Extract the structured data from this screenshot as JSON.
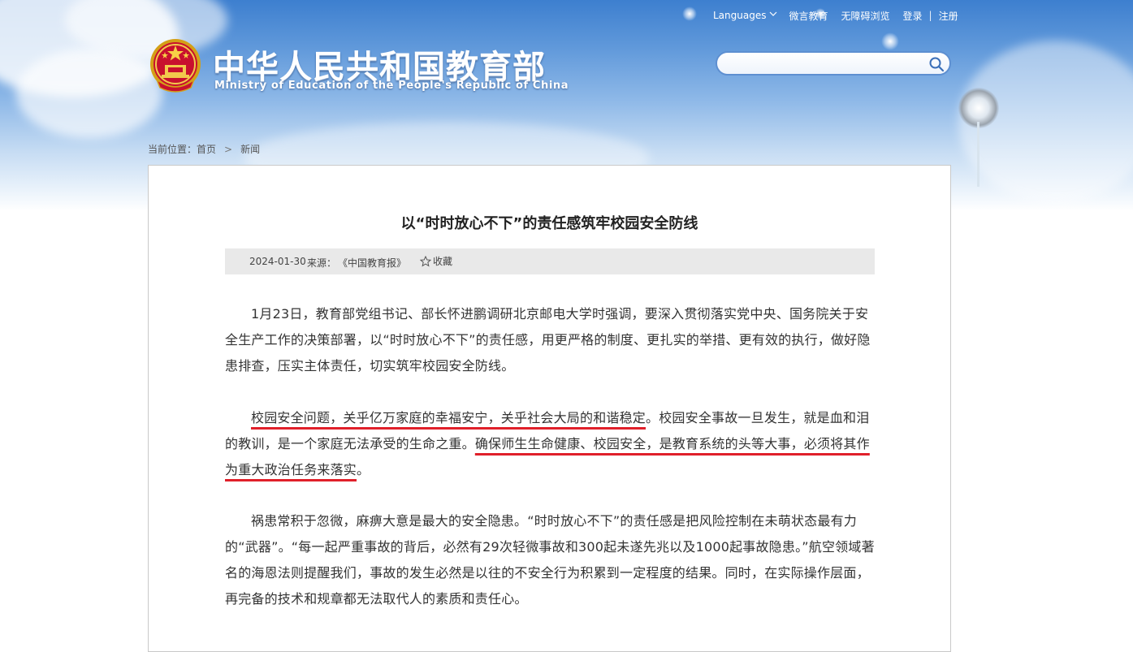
{
  "header": {
    "languages_label": "Languages",
    "links": [
      "微言教育",
      "无障碍浏览",
      "登录",
      "注册"
    ],
    "brand_cn": "中华人民共和国教育部",
    "brand_en": "Ministry of Education of the People's Republic of China",
    "search": {
      "placeholder": "",
      "value": ""
    }
  },
  "breadcrumb": {
    "prefix": "当前位置：",
    "items": [
      "首页",
      "新闻"
    ]
  },
  "article": {
    "title": "以“时时放心不下”的责任感筑牢校园安全防线",
    "date": "2024-01-30",
    "source_label": "来源：",
    "source": "《中国教育报》",
    "favorite_label": "收藏",
    "p1": "1月23日，教育部党组书记、部长怀进鹏调研北京邮电大学时强调，要深入贯彻落实党中央、国务院关于安全生产工作的决策部署，以“时时放心不下”的责任感，用更严格的制度、更扎实的举措、更有效的执行，做好隐患排查，压实主体责任，切实筑牢校园安全防线。",
    "p2_underline_a": "校园安全问题，关乎亿万家庭的幸福安宁，关乎社会大局的和谐稳定",
    "p2_mid": "。校园安全事故一旦发生，就是血和泪的教训，是一个家庭无法承受的生命之重。",
    "p2_underline_b": "确保师生生命健康、校园安全，是教育系统的头等大事，必须将其作为重大政治任务来落实",
    "p2_end": "。",
    "p3": "祸患常积于忽微，麻痹大意是最大的安全隐患。“时时放心不下”的责任感是把风险控制在未萌状态最有力的“武器”。“每一起严重事故的背后，必然有29次轻微事故和300起未遂先兆以及1000起事故隐患。”航空领域著名的海恩法则提醒我们，事故的发生必然是以往的不安全行为积累到一定程度的结果。同时，在实际操作层面，再完备的技术和规章都无法取代人的素质和责任心。"
  },
  "colors": {
    "sky_top": "#3d7fcf",
    "underline": "#e0202a",
    "search_border": "#5d8fd1",
    "meta_bg": "#e9e9e9"
  }
}
